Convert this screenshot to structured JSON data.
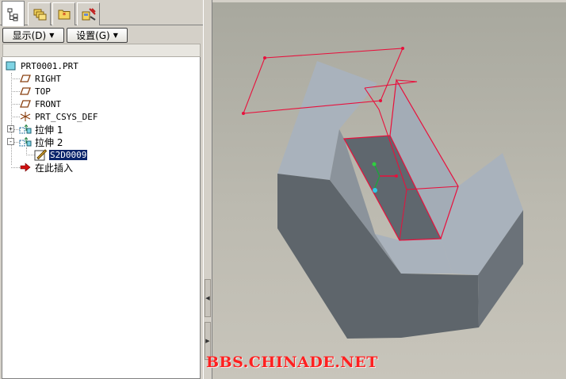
{
  "tabs": [
    {
      "icon": "model-tree-icon",
      "active": true
    },
    {
      "icon": "folder-browser-icon",
      "active": false
    },
    {
      "icon": "favorites-icon",
      "active": false
    },
    {
      "icon": "connections-icon",
      "active": false
    }
  ],
  "toolbar": {
    "show_label": "显示(D)",
    "settings_label": "设置(G)"
  },
  "tree": {
    "root": "PRT0001.PRT",
    "items": [
      {
        "label": "RIGHT",
        "icon": "datum-plane-icon"
      },
      {
        "label": "TOP",
        "icon": "datum-plane-icon"
      },
      {
        "label": "FRONT",
        "icon": "datum-plane-icon"
      },
      {
        "label": "PRT_CSYS_DEF",
        "icon": "coordinate-system-icon"
      },
      {
        "label": "拉伸 1",
        "icon": "extrude-icon",
        "expander": "+"
      },
      {
        "label": "拉伸 2",
        "icon": "extrude-icon",
        "expander": "-"
      },
      {
        "label": "S2D0009",
        "icon": "sketch-icon",
        "selected": true
      },
      {
        "label": "在此插入",
        "icon": "insert-here-arrow-icon"
      }
    ]
  },
  "colors": {
    "selection": "#0a246a",
    "sketch_highlight": "#e8103c",
    "part_light": "#a9b2bc",
    "part_dark": "#5e656b",
    "watermark": "#ff2020"
  },
  "watermark": "BBS.CHINADE.NET"
}
